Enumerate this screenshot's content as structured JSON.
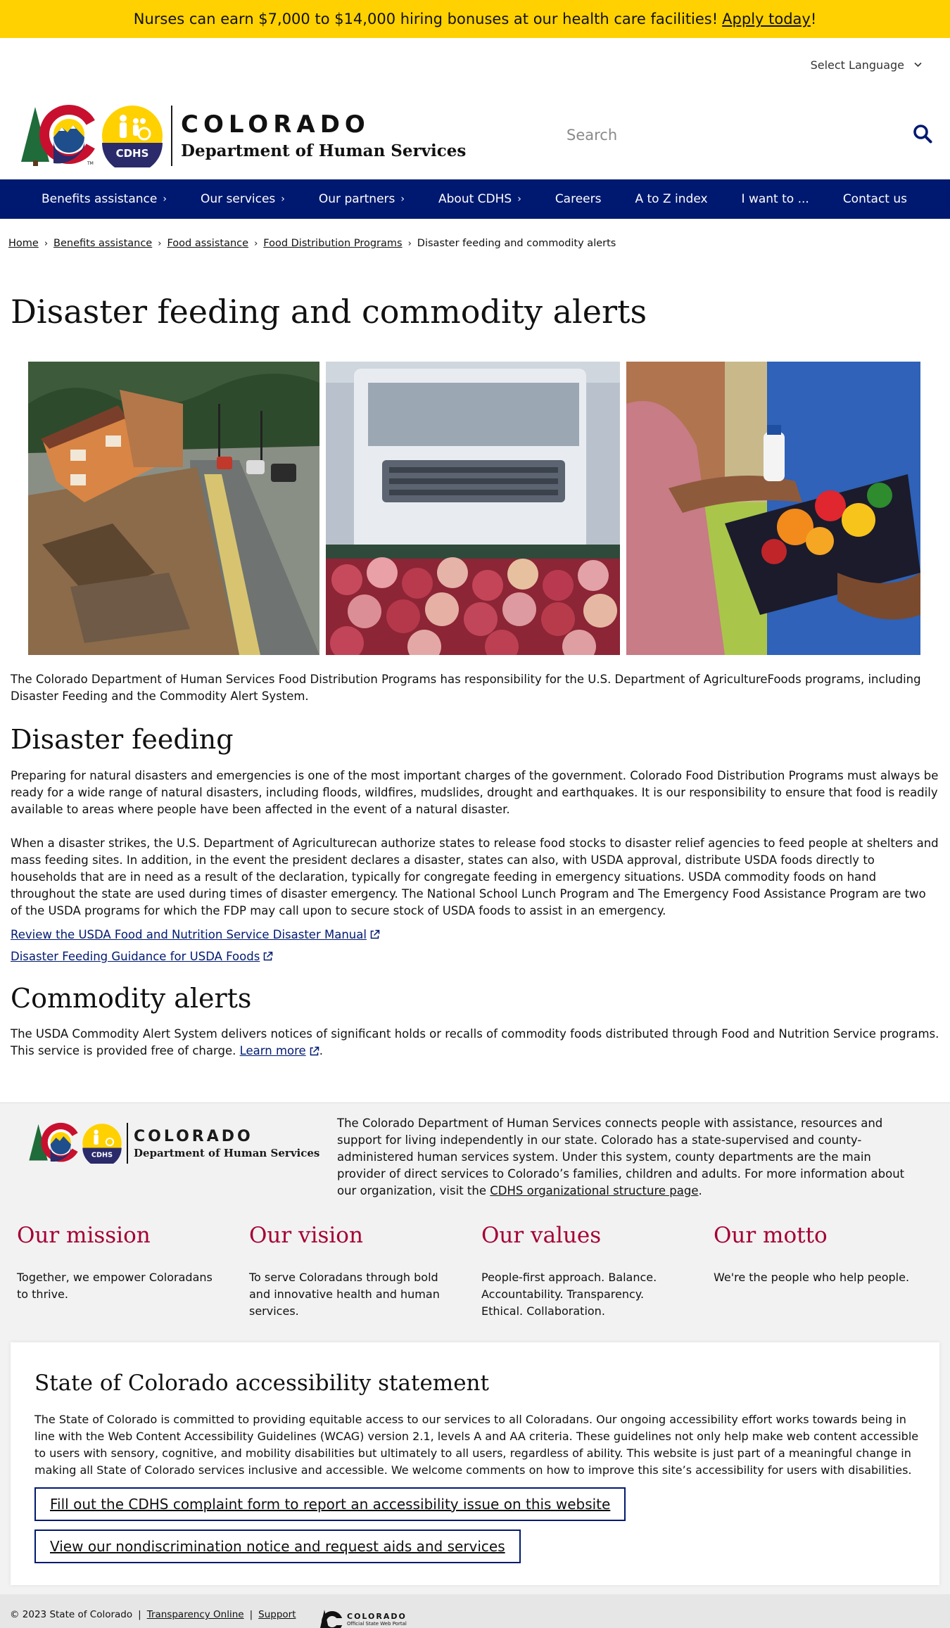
{
  "alert": {
    "text": "Nurses can earn $7,000 to $14,000 hiring bonuses at our health care facilities!",
    "link": "Apply today",
    "suffix": "!"
  },
  "header": {
    "language_label": "Select Language",
    "logo_line1": "COLORADO",
    "logo_line2": "Department of Human Services",
    "logo_badge": "CDHS",
    "search_placeholder": "Search"
  },
  "nav": {
    "items": [
      {
        "label": "Benefits assistance",
        "has_arrow": true
      },
      {
        "label": "Our services",
        "has_arrow": true
      },
      {
        "label": "Our partners",
        "has_arrow": true
      },
      {
        "label": "About CDHS",
        "has_arrow": true
      },
      {
        "label": "Careers",
        "has_arrow": false
      },
      {
        "label": "A to Z index",
        "has_arrow": false
      },
      {
        "label": "I want to ...",
        "has_arrow": false
      },
      {
        "label": "Contact us",
        "has_arrow": false
      }
    ]
  },
  "breadcrumb": {
    "items": [
      "Home",
      "Benefits assistance",
      "Food assistance",
      "Food Distribution Programs"
    ],
    "current": "Disaster feeding and commodity alerts"
  },
  "page": {
    "title": "Disaster feeding and commodity alerts",
    "intro": "The Colorado Department of Human Services Food Distribution Programs has responsibility for the U.S. Department of AgricultureFoods programs, including Disaster Feeding and the Commodity Alert System.",
    "disaster_heading": "Disaster feeding",
    "disaster_p1": "Preparing for natural disasters and emergencies is one of the most important charges of the government. Colorado Food Distribution Programs must always be ready for a wide range of natural disasters, including floods, wildfires, mudslides, drought and earthquakes. It is our responsibility to ensure that food is readily available to areas where people have been affected in the event of a natural disaster.",
    "disaster_p2": "When a disaster strikes, the U.S. Department of Agriculturecan authorize states to release food stocks to disaster relief agencies to feed people at shelters and mass feeding sites. In addition, in the event the president declares a disaster, states can also, with USDA approval, distribute USDA foods directly to households that are in need as a result of the declaration, typically for congregate feeding in emergency situations. USDA commodity foods on hand throughout the state are used during times of disaster emergency. The National School Lunch Program and The Emergency Food Assistance Program are two of the USDA programs for which the FDP may call upon to secure stock of USDA foods to assist in an emergency.",
    "link1": "Review the USDA Food and Nutrition Service Disaster Manual",
    "link2": "Disaster Feeding Guidance for USDA Foods",
    "commodity_heading": "Commodity alerts",
    "commodity_text": "The USDA Commodity Alert System delivers notices of significant holds or recalls of commodity foods distributed through Food and Nutrition Service programs. This service is provided free of charge.",
    "commodity_link": "Learn more",
    "commodity_suffix": "."
  },
  "footer": {
    "about_text": "The Colorado Department of Human Services connects people with assistance, resources and support for living independently in our state. Colorado has a state-supervised and county-administered human services system. Under this system, county departments are the main provider of direct services to Colorado’s families, children and adults. For more information about our organization, visit the",
    "about_link": "CDHS organizational structure page",
    "about_suffix": ".",
    "columns": [
      {
        "heading": "Our mission",
        "text": "Together, we empower Coloradans to thrive."
      },
      {
        "heading": "Our vision",
        "text": "To serve Coloradans through bold and innovative health and human services."
      },
      {
        "heading": "Our values",
        "text": "People-first approach. Balance. Accountability. Transparency. Ethical. Collaboration."
      },
      {
        "heading": "Our motto",
        "text": "We're the people who help people."
      }
    ],
    "a11y_heading": "State of Colorado accessibility statement",
    "a11y_text": "The State of Colorado is committed to providing equitable access to our services to all Coloradans. Our ongoing accessibility effort works towards being in line with the Web Content Accessibility Guidelines (WCAG) version 2.1, levels A and AA criteria. These guidelines not only help make web content accessible to users with sensory, cognitive, and mobility disabilities but ultimately to all users, regardless of ability. This website is just part of a meaningful change in making all State of Colorado services inclusive and accessible. We welcome comments on how to improve this site’s accessibility for users with disabilities.",
    "a11y_btn1": "Fill out the CDHS complaint form to report an accessibility issue on this website",
    "a11y_btn2": "View our nondiscrimination notice and request aids and services",
    "copyright": "© 2023 State of Colorado",
    "transparency": "Transparency Online",
    "support": "Support",
    "portal_line1": "COLORADO",
    "portal_line2": "Official State Web Portal"
  },
  "colors": {
    "banner": "#ffd100",
    "nav": "#001970",
    "footer_heading": "#a50034",
    "link": "#001970"
  },
  "icons": [
    "search-icon",
    "chevron-down-icon",
    "chevron-right-icon",
    "external-link-icon",
    "colorado-c-logo",
    "cdhs-badge-logo"
  ]
}
